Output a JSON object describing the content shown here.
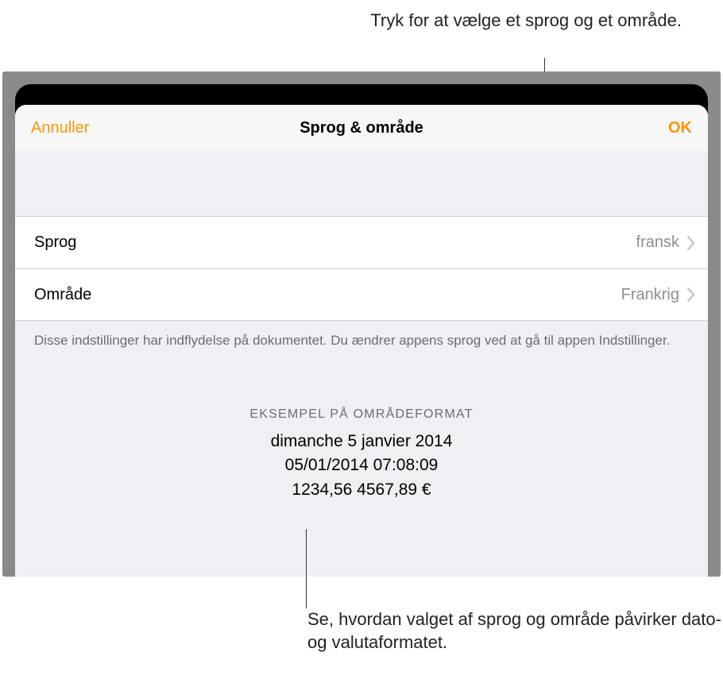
{
  "callouts": {
    "top": "Tryk for at vælge et sprog og et område.",
    "bottom": "Se, hvordan valget af sprog og område påvirker dato- og valutaformatet."
  },
  "header": {
    "cancel": "Annuller",
    "title": "Sprog & område",
    "ok": "OK"
  },
  "rows": {
    "language": {
      "label": "Sprog",
      "value": "fransk"
    },
    "region": {
      "label": "Område",
      "value": "Frankrig"
    }
  },
  "footer_note": "Disse indstillinger har indflydelse på dokumentet. Du ændrer appens sprog ved at gå til appen Indstillinger.",
  "example": {
    "header": "EKSEMPEL PÅ OMRÅDEFORMAT",
    "line1": "dimanche 5 janvier 2014",
    "line2": "05/01/2014   07:08:09",
    "line3": "1234,56   4567,89 €"
  }
}
